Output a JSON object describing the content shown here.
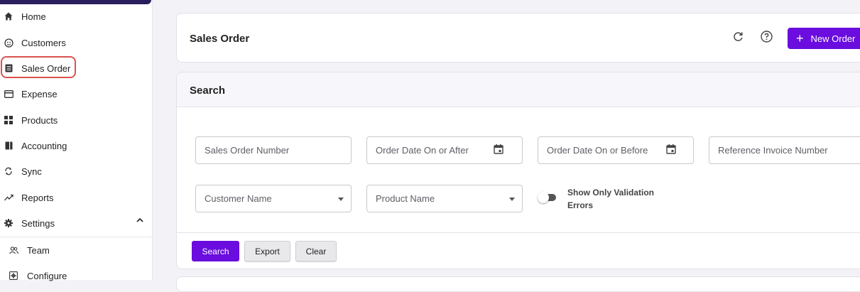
{
  "sidebar": {
    "items": [
      {
        "label": "Home",
        "icon": "home-icon"
      },
      {
        "label": "Customers",
        "icon": "customers-icon"
      },
      {
        "label": "Sales Order",
        "icon": "sales-order-icon",
        "active": true
      },
      {
        "label": "Expense",
        "icon": "expense-icon"
      },
      {
        "label": "Products",
        "icon": "products-icon"
      },
      {
        "label": "Accounting",
        "icon": "accounting-icon"
      },
      {
        "label": "Sync",
        "icon": "sync-icon"
      },
      {
        "label": "Reports",
        "icon": "reports-icon"
      },
      {
        "label": "Settings",
        "icon": "settings-icon",
        "expanded": true
      },
      {
        "label": "Team",
        "icon": "team-icon"
      },
      {
        "label": "Configure",
        "icon": "configure-icon"
      }
    ],
    "highlight_color": "#d9534f"
  },
  "header": {
    "title": "Sales Order",
    "new_order_label": "New Order",
    "accent_color": "#6a0dde"
  },
  "search": {
    "title": "Search",
    "fields": {
      "sales_order_number": "Sales Order Number",
      "order_date_after": "Order Date On or After",
      "order_date_before": "Order Date On or Before",
      "reference_invoice": "Reference Invoice Number",
      "customer_name": "Customer Name",
      "product_name": "Product Name"
    },
    "toggle_label": "Show Only Validation Errors",
    "toggle_on": false,
    "buttons": {
      "search": "Search",
      "export": "Export",
      "clear": "Clear"
    }
  }
}
